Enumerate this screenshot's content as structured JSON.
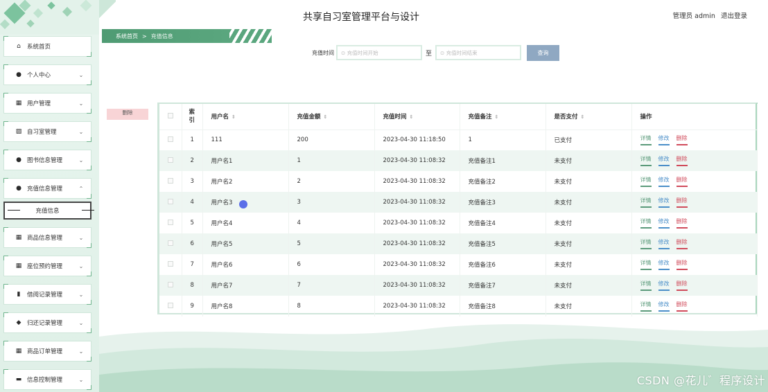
{
  "header": {
    "title": "共享自习室管理平台与设计",
    "user_label": "管理员 admin",
    "logout": "退出登录"
  },
  "breadcrumb": {
    "home": "系统首页",
    "sep": ">",
    "current": "充值信息"
  },
  "search": {
    "label": "充值时间",
    "start_placeholder": "⊙ 充值时间开始",
    "to": "至",
    "end_placeholder": "⊙ 充值时间结束",
    "button": "查询"
  },
  "delete_button": "删除",
  "sidebar": {
    "items": [
      {
        "label": "系统首页",
        "icon": "home-icon",
        "glyph": "⌂"
      },
      {
        "label": "个人中心",
        "icon": "user-icon",
        "glyph": "●"
      },
      {
        "label": "用户管理",
        "icon": "grid-icon",
        "glyph": "▦"
      },
      {
        "label": "自习室管理",
        "icon": "chart-icon",
        "glyph": "▨"
      },
      {
        "label": "图书信息管理",
        "icon": "user-icon",
        "glyph": "●"
      },
      {
        "label": "充值信息管理",
        "icon": "user-icon",
        "glyph": "●"
      },
      {
        "label": "商品信息管理",
        "icon": "grid-icon",
        "glyph": "▦"
      },
      {
        "label": "座位预约管理",
        "icon": "grid-icon",
        "glyph": "▦"
      },
      {
        "label": "借阅记录管理",
        "icon": "bar-icon",
        "glyph": "▮"
      },
      {
        "label": "归还记录管理",
        "icon": "pin-icon",
        "glyph": "◆"
      },
      {
        "label": "商品订单管理",
        "icon": "grid-icon",
        "glyph": "▦"
      },
      {
        "label": "信息控制管理",
        "icon": "monitor-icon",
        "glyph": "▬"
      }
    ],
    "submenu_label": "充值信息"
  },
  "table": {
    "headers": [
      "索引",
      "用户名",
      "充值金额",
      "充值时间",
      "充值备注",
      "是否支付",
      "操作"
    ],
    "index_header_l1": "索",
    "index_header_l2": "引",
    "sort_glyph": "⇕",
    "actions": {
      "detail": "详情",
      "edit": "修改",
      "delete": "删除"
    },
    "rows": [
      {
        "idx": "1",
        "user": "111",
        "amount": "200",
        "time": "2023-04-30 11:18:50",
        "note": "1",
        "paid": "已支付"
      },
      {
        "idx": "2",
        "user": "用户名1",
        "amount": "1",
        "time": "2023-04-30 11:08:32",
        "note": "充值备注1",
        "paid": "未支付"
      },
      {
        "idx": "3",
        "user": "用户名2",
        "amount": "2",
        "time": "2023-04-30 11:08:32",
        "note": "充值备注2",
        "paid": "未支付"
      },
      {
        "idx": "4",
        "user": "用户名3",
        "amount": "3",
        "time": "2023-04-30 11:08:32",
        "note": "充值备注3",
        "paid": "未支付"
      },
      {
        "idx": "5",
        "user": "用户名4",
        "amount": "4",
        "time": "2023-04-30 11:08:32",
        "note": "充值备注4",
        "paid": "未支付"
      },
      {
        "idx": "6",
        "user": "用户名5",
        "amount": "5",
        "time": "2023-04-30 11:08:32",
        "note": "充值备注5",
        "paid": "未支付"
      },
      {
        "idx": "7",
        "user": "用户名6",
        "amount": "6",
        "time": "2023-04-30 11:08:32",
        "note": "充值备注6",
        "paid": "未支付"
      },
      {
        "idx": "8",
        "user": "用户名7",
        "amount": "7",
        "time": "2023-04-30 11:08:32",
        "note": "充值备注7",
        "paid": "未支付"
      },
      {
        "idx": "9",
        "user": "用户名8",
        "amount": "8",
        "time": "2023-04-30 11:08:32",
        "note": "充值备注8",
        "paid": "未支付"
      }
    ]
  },
  "watermark": "CSDN @花儿゛程序设计",
  "colors": {
    "accent": "#5aa67e",
    "query_button": "#8fa8c2",
    "delete_bg": "#f8d4d6",
    "detail": "#5a9a7a",
    "edit": "#4a8ec8",
    "danger": "#d04a5a"
  }
}
